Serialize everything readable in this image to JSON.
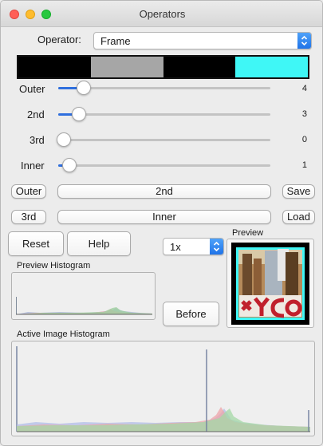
{
  "window": {
    "title": "Operators"
  },
  "operator": {
    "label": "Operator:",
    "selected": "Frame"
  },
  "colorbar": {
    "segments": [
      "#000000",
      "#a6a6a6",
      "#000000",
      "#3ff7f6"
    ]
  },
  "sliders": [
    {
      "label": "Outer",
      "value": "4",
      "fraction": 0.095
    },
    {
      "label": "2nd",
      "value": "3",
      "fraction": 0.07
    },
    {
      "label": "3rd",
      "value": "0",
      "fraction": 0.0
    },
    {
      "label": "Inner",
      "value": "1",
      "fraction": 0.025
    }
  ],
  "buttons": {
    "outer": "Outer",
    "second": "2nd",
    "save": "Save",
    "third": "3rd",
    "inner": "Inner",
    "load": "Load",
    "reset": "Reset",
    "help": "Help",
    "before": "Before"
  },
  "zoom": {
    "selected": "1x"
  },
  "preview": {
    "label": "Preview"
  },
  "histograms": {
    "preview_label": "Preview Histogram",
    "active_label": "Active Image Histogram"
  },
  "colors": {
    "accent": "#2f6fde",
    "slider_track": "#c3c3c3"
  },
  "icons": {
    "select_arrows": "chevron-updown-icon"
  }
}
